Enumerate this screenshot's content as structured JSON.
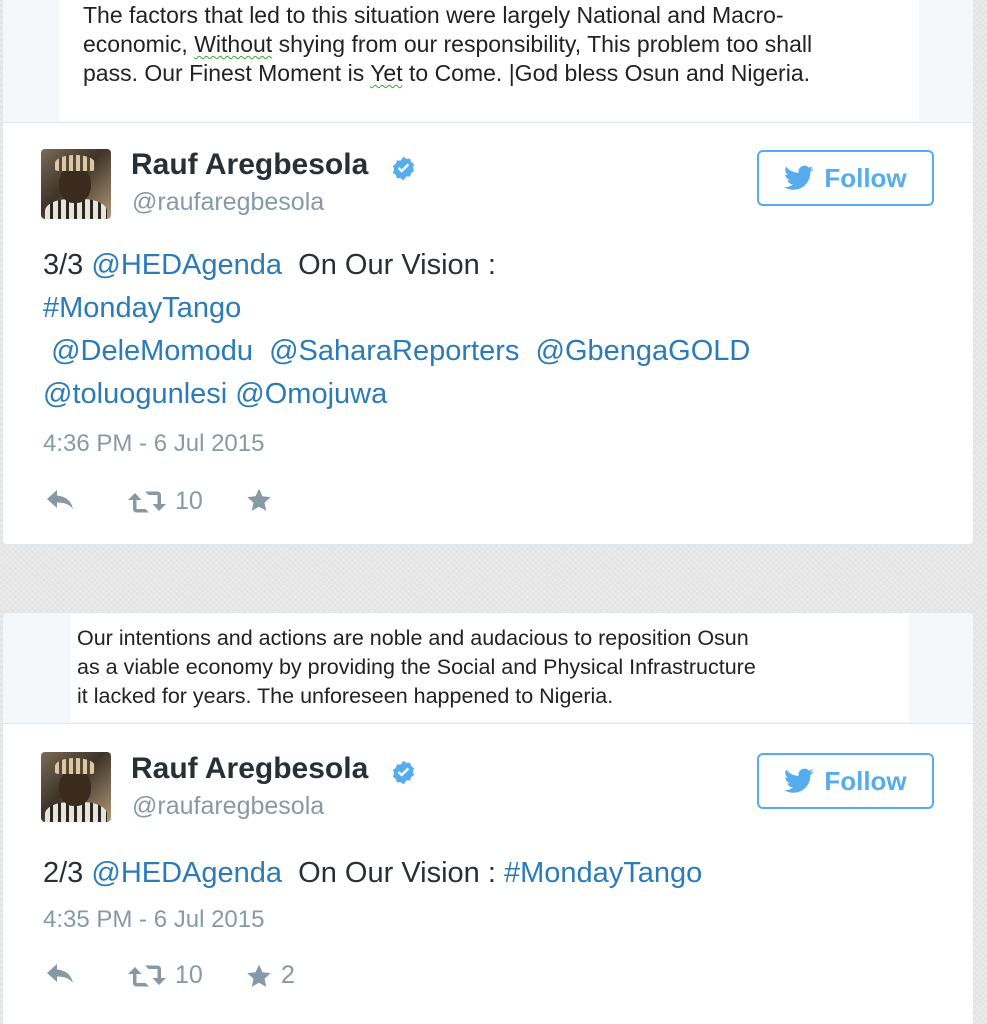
{
  "tweets": [
    {
      "media_lines": [
        [
          "The factors that led to this situation were largely National and Macro-"
        ],
        [
          "economic, ",
          {
            "squiggle": "Without"
          },
          " shying from our responsibility, This problem too shall"
        ],
        [
          "pass. Our Finest Moment is ",
          {
            "squiggle": "Yet"
          },
          " to Come. |God bless Osun and Nigeria."
        ]
      ],
      "name": "Rauf Aregbesola",
      "handle": "@raufaregbesola",
      "follow_label": "Follow",
      "text_prefix": "3/3",
      "mention_hed": "@HEDAgenda",
      "text_mid": "On Our Vision :",
      "hashtag": "#MondayTango",
      "mentions_line1": [
        "@DeleMomodu",
        "@SaharaReporters",
        "@GbengaGOLD"
      ],
      "mentions_line2": [
        "@toluogunlesi",
        "@Omojuwa"
      ],
      "timestamp": "4:36 PM - 6 Jul 2015",
      "retweet_count": "10",
      "favorite_count": ""
    },
    {
      "media_lines": [
        [
          "Our intentions and actions are noble and audacious to reposition Osun"
        ],
        [
          "as a viable economy by providing the Social and Physical Infrastructure"
        ],
        [
          "it lacked for years. The unforeseen happened to Nigeria."
        ]
      ],
      "name": "Rauf Aregbesola",
      "handle": "@raufaregbesola",
      "follow_label": "Follow",
      "text_prefix": "2/3",
      "mention_hed": "@HEDAgenda",
      "text_mid": "On Our Vision :",
      "hashtag": "#MondayTango",
      "timestamp": "4:35 PM - 6 Jul 2015",
      "retweet_count": "10",
      "favorite_count": "2"
    }
  ],
  "colors": {
    "link": "#2b7bb9",
    "follow": "#55acee",
    "muted": "#8899a6",
    "verified": "#55acee"
  },
  "icons": [
    "verified-badge-icon",
    "twitter-bird-icon",
    "reply-icon",
    "retweet-icon",
    "favorite-star-icon"
  ]
}
